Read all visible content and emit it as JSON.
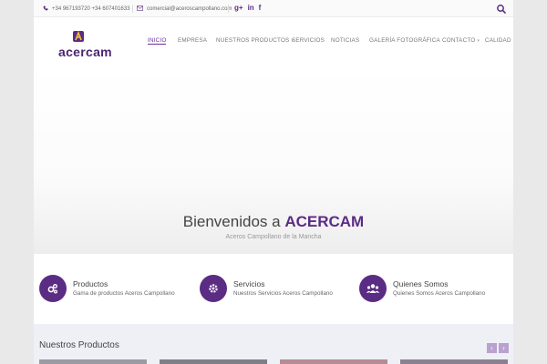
{
  "topbar": {
    "phone": "+34 967193720 +34 607401633",
    "email": "comercial@aceroscampollano.com",
    "social": [
      "g+",
      "in",
      "f"
    ],
    "phone_icon": "phone-icon",
    "email_icon": "envelope-icon",
    "search_icon": "search-icon"
  },
  "logo": {
    "text": "acercam"
  },
  "nav": {
    "items": [
      "INICIO",
      "EMPRESA",
      "NUESTROS PRODUCTOS",
      "SERVICIOS",
      "NOTICIAS",
      "GALERÍA FOTOGRÁFICA",
      "CONTACTO",
      "CALIDAD"
    ],
    "active": "INICIO"
  },
  "hero": {
    "title_prefix": "Bienvenidos a",
    "title_brand": "ACERCAM",
    "subtitle": "Aceros Campollano de la Mancha"
  },
  "features": [
    {
      "title": "Productos",
      "desc": "Gama de productos Aceros Campollano",
      "icon": "gears-icon"
    },
    {
      "title": "Servicios",
      "desc": "Nuestros Servicios Aceros Campollano",
      "icon": "gear-icon"
    },
    {
      "title": "Quienes Somos",
      "desc": "Quienes Somos Aceros Campollano",
      "icon": "users-icon"
    }
  ],
  "products": {
    "title": "Nuestros Productos",
    "prev": "‹",
    "next": "›"
  },
  "colors": {
    "brand": "#5b2c83",
    "accent": "#6c2f9c"
  }
}
